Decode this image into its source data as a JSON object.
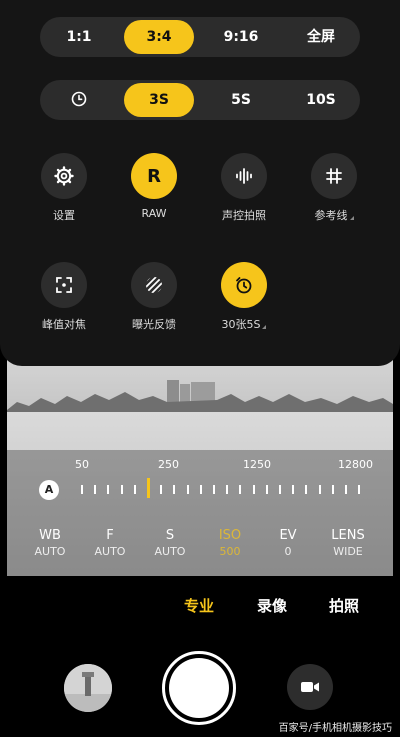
{
  "aspect_ratio": {
    "options": [
      "1:1",
      "3:4",
      "9:16",
      "全屏"
    ],
    "selected": "3:4"
  },
  "timer": {
    "options": [
      "3S",
      "5S",
      "10S"
    ],
    "selected": "3S",
    "off_icon": "clock-icon"
  },
  "tools": {
    "settings": {
      "label": "设置",
      "icon": "gear-icon"
    },
    "raw": {
      "label": "RAW",
      "letter": "R"
    },
    "voice": {
      "label": "声控拍照",
      "icon": "waveform-icon"
    },
    "grid": {
      "label": "参考线",
      "icon": "grid-icon"
    },
    "peaking": {
      "label": "峰值对焦",
      "icon": "focus-peaking-icon"
    },
    "exposure": {
      "label": "曝光反馈",
      "icon": "zebra-stripes-icon"
    },
    "burst": {
      "label": "30张5S",
      "icon": "timer-burst-icon"
    }
  },
  "pro": {
    "auto_letter": "A",
    "iso_scale": [
      "50",
      "250",
      "1250",
      "12800"
    ],
    "params": [
      {
        "key": "WB",
        "value": "AUTO"
      },
      {
        "key": "F",
        "value": "AUTO"
      },
      {
        "key": "S",
        "value": "AUTO"
      },
      {
        "key": "ISO",
        "value": "500"
      },
      {
        "key": "EV",
        "value": "0"
      },
      {
        "key": "LENS",
        "value": "WIDE"
      }
    ]
  },
  "modes": {
    "pro": "专业",
    "video": "录像",
    "photo": "拍照",
    "active": "专业"
  },
  "colors": {
    "accent": "#f6c51b",
    "panel": "#151515",
    "pill": "#2c2c2c"
  },
  "watermark": "百家号/手机相机摄影技巧"
}
